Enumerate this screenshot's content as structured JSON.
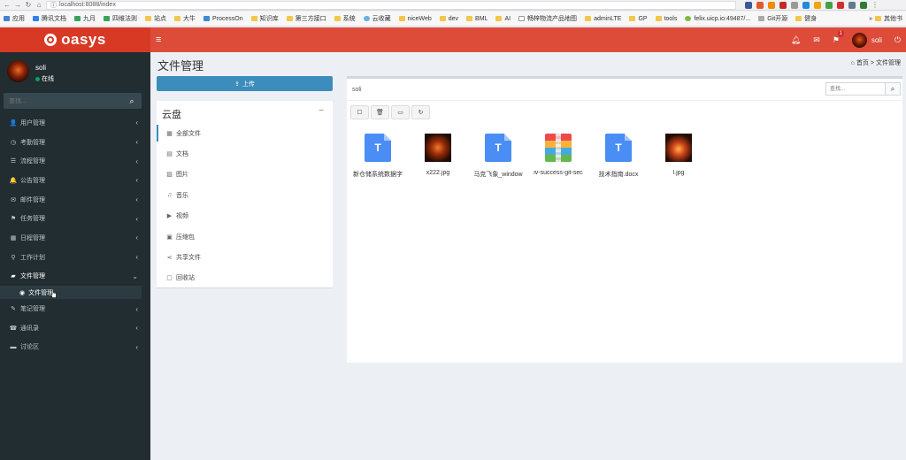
{
  "browser": {
    "url": "localhost:8088/index",
    "bookmarks": [
      "应用",
      "腾讯文档",
      "九月",
      "四维法则",
      "站点",
      "大牛",
      "ProcessOn",
      "知识库",
      "第三方接口",
      "系统",
      "云收藏",
      "niceWeb",
      "dev",
      "BML",
      "AI",
      "畅梓物流产品地图",
      "adminLTE",
      "GP",
      "tools",
      "felix.uicp.io:49487/...",
      "Git开源",
      "健身"
    ],
    "other_bookmarks": "其他书"
  },
  "header": {
    "logo_text": "oasys",
    "notification_count": "1",
    "user_name": "soli"
  },
  "sidebar": {
    "user_name": "soli",
    "status": "在线",
    "search_placeholder": "查找...",
    "items": [
      {
        "label": "用户管理",
        "icon": "user-icon",
        "glyph": "👤"
      },
      {
        "label": "考勤管理",
        "icon": "clock-icon",
        "glyph": "◷"
      },
      {
        "label": "流程管理",
        "icon": "flow-icon",
        "glyph": "☰"
      },
      {
        "label": "公告管理",
        "icon": "bell-icon",
        "glyph": "🔔"
      },
      {
        "label": "邮件管理",
        "icon": "envelope-icon",
        "glyph": "✉"
      },
      {
        "label": "任务管理",
        "icon": "flag-icon",
        "glyph": "⚑"
      },
      {
        "label": "日程管理",
        "icon": "calendar-icon",
        "glyph": "▦"
      },
      {
        "label": "工作计划",
        "icon": "pin-icon",
        "glyph": "⚲"
      },
      {
        "label": "文件管理",
        "icon": "folder-open-icon",
        "glyph": "▰"
      },
      {
        "label": "笔记管理",
        "icon": "edit-icon",
        "glyph": "✎"
      },
      {
        "label": "通讯录",
        "icon": "phone-icon",
        "glyph": "☎"
      },
      {
        "label": "讨论区",
        "icon": "comment-icon",
        "glyph": "▬"
      }
    ],
    "submenu_label": "文件管理"
  },
  "content": {
    "page_title": "文件管理",
    "breadcrumb_home": "首页",
    "breadcrumb_sep": ">",
    "breadcrumb_current": "文件管理",
    "upload_label": "上传",
    "cloud_title": "云盘",
    "folders": [
      {
        "label": "全部文件",
        "icon": "grid-icon",
        "glyph": "▦"
      },
      {
        "label": "文档",
        "icon": "file-text-icon",
        "glyph": "▤"
      },
      {
        "label": "图片",
        "icon": "image-icon",
        "glyph": "▨"
      },
      {
        "label": "音乐",
        "icon": "music-icon",
        "glyph": "♫"
      },
      {
        "label": "视频",
        "icon": "play-icon",
        "glyph": "▶"
      },
      {
        "label": "压缩包",
        "icon": "archive-icon",
        "glyph": "▣"
      },
      {
        "label": "共享文件",
        "icon": "share-icon",
        "glyph": "⋖"
      },
      {
        "label": "回收站",
        "icon": "trash-icon",
        "glyph": "▢"
      }
    ],
    "path": "soli",
    "search_placeholder": "查找...",
    "files": [
      {
        "name": "新仓储系统数据字",
        "type": "doc"
      },
      {
        "name": "x222.jpg",
        "type": "image"
      },
      {
        "name": "马克飞象_window",
        "type": "doc"
      },
      {
        "name": "iv-success-git-sec",
        "type": "zip"
      },
      {
        "name": "技术指南.docx",
        "type": "doc"
      },
      {
        "name": "l.jpg",
        "type": "image2"
      }
    ]
  },
  "colors": {
    "header": "#dd4b39",
    "logo_bg": "#d73925",
    "sidebar": "#222d32",
    "primary": "#3c8dbc"
  }
}
